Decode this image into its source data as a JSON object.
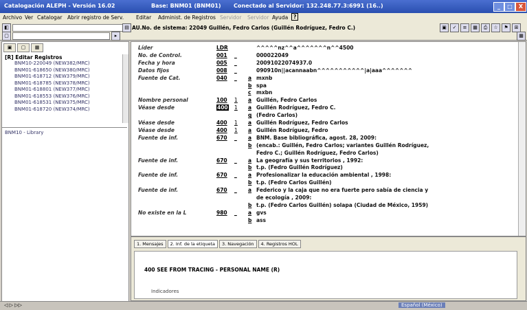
{
  "titlebar": {
    "app": "Catalogación ALEPH - Versión 16.02",
    "base": "Base: BNM01 (BNM01)",
    "server": "Conectado al Servidor: 132.248.77.3:6991 (16..)",
    "minimize": "_",
    "maximize": "□",
    "close": "X"
  },
  "menu": {
    "items": [
      "Archivo",
      "Ver",
      "Catalogar",
      "Abrir registro de Serv.",
      "Editar",
      "Administ. de Registros",
      "Servidor",
      "Servidor",
      "Ayuda"
    ],
    "help_box": "?"
  },
  "header": {
    "record_title": "AU.No. de sistema: 22049 Guillén, Fedro Carlos (Guillén Rodríguez, Fedro C.)"
  },
  "left_panel": {
    "tabs": [
      "▣",
      "▢",
      "▦"
    ],
    "root": "[R] Editar Registros",
    "items": [
      "BNM10-220049 (NEW382/MRC)",
      "BNM01-618650 (NEW380/MRC)",
      "BNM01-618712 (NEW379/MRC)",
      "BNM01-618785 (NEW378/MRC)",
      "BNM01-618801 (NEW377/MRC)",
      "BNM01-618553 (NEW376/MRC)",
      "BNM01-618531 (NEW375/MRC)",
      "BNM01-618720 (NEW374/MRC)"
    ],
    "sub_item": "BNM10 - Library"
  },
  "record_rows": [
    {
      "label": "Líder",
      "tag": "LDR",
      "ind": "",
      "sub": "",
      "val": "^^^^^nz^^a^^^^^^^n^^4500"
    },
    {
      "label": "No. de Control.",
      "tag": "001",
      "ind": "_",
      "sub": "",
      "val": "000022049"
    },
    {
      "label": "Fecha y hora",
      "tag": "005",
      "ind": "_",
      "sub": "",
      "val": "20091022074937.0"
    },
    {
      "label": "Datos fijos",
      "tag": "008",
      "ind": "_",
      "sub": "",
      "val": "090910n||acannaabn^^^^^^^^^^^|a|aaa^^^^^^^"
    },
    {
      "label": "Fuente de Cat.",
      "tag": "040",
      "ind": "_",
      "sub": "a",
      "val": "mxnb"
    },
    {
      "label": "",
      "tag": "",
      "ind": "",
      "sub": "b",
      "val": "spa"
    },
    {
      "label": "",
      "tag": "",
      "ind": "",
      "sub": "c",
      "val": "mxbn"
    },
    {
      "label": "Nombre personal",
      "tag": "100",
      "ind": "1",
      "sub": "a",
      "val": "Guillén, Fedro Carlos"
    },
    {
      "label": "Véase desde",
      "tag": "400",
      "ind": "1",
      "sub": "a",
      "val": "Guillén Rodríguez, Fedro C.",
      "hl": true
    },
    {
      "label": "",
      "tag": "",
      "ind": "",
      "sub": "q",
      "val": "(Fedro Carlos)"
    },
    {
      "label": "Véase desde",
      "tag": "400",
      "ind": "1",
      "sub": "a",
      "val": "Guillén Rodríguez, Fedro Carlos"
    },
    {
      "label": "Véase desde",
      "tag": "400",
      "ind": "1",
      "sub": "a",
      "val": "Guillén Rodríguez, Fedro"
    },
    {
      "label": "Fuente de inf.",
      "tag": "670",
      "ind": "_",
      "sub": "a",
      "val": "BNM. Base bibliográfica, agost. 28, 2009:"
    },
    {
      "label": "",
      "tag": "",
      "ind": "",
      "sub": "b",
      "val": "(encab.: Guillén, Fedro Carlos; variantes Guillén Rodríguez,"
    },
    {
      "label": "",
      "tag": "",
      "ind": "",
      "sub": "",
      "val": "Fedro C.; Guillén Rodríguez, Fedro Carlos)"
    },
    {
      "label": "Fuente de inf.",
      "tag": "670",
      "ind": "_",
      "sub": "a",
      "val": "La geografía y sus territorios , 1992:"
    },
    {
      "label": "",
      "tag": "",
      "ind": "",
      "sub": "b",
      "val": "t.p. (Fedro Guillén Rodríguez)"
    },
    {
      "label": "Fuente de inf.",
      "tag": "670",
      "ind": "_",
      "sub": "a",
      "val": "Profesionalizar la educación ambiental , 1998:"
    },
    {
      "label": "",
      "tag": "",
      "ind": "",
      "sub": "b",
      "val": "t.p. (Fedro Carlos Guillén)"
    },
    {
      "label": "Fuente de inf.",
      "tag": "670",
      "ind": "_",
      "sub": "a",
      "val": "Federico y la caja que no era fuerte pero sabía de ciencia y"
    },
    {
      "label": "",
      "tag": "",
      "ind": "",
      "sub": "",
      "val": "de ecología , 2009:"
    },
    {
      "label": "",
      "tag": "",
      "ind": "",
      "sub": "b",
      "val": "t.p. (Fedro Carlos Guillén) solapa (Ciudad de México, 1959)"
    },
    {
      "label": "No existe en la L",
      "tag": "980",
      "ind": "_",
      "sub": "a",
      "val": "gvs"
    },
    {
      "label": "",
      "tag": "",
      "ind": "",
      "sub": "b",
      "val": "ass"
    }
  ],
  "bottom_panel": {
    "tabs": [
      "1. Mensajes",
      "2. Inf. de la etiqueta",
      "3. Navegación",
      "4. Registros HOL"
    ],
    "field_title": "400 SEE FROM TRACING - PERSONAL NAME (R)",
    "indicators_label": "Indicadores"
  },
  "statusbar": {
    "left": "◁ ▷ ▷▷",
    "lang": "Español (México)"
  }
}
